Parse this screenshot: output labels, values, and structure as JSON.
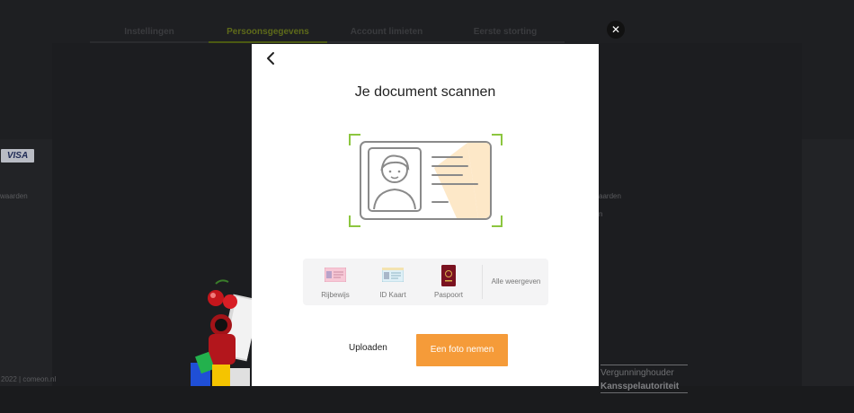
{
  "steps": [
    "Instellingen",
    "Persoonsgegevens",
    "Account limieten",
    "Eerste storting"
  ],
  "background": {
    "visa_label": "VISA",
    "left_text": "waarden",
    "right_text_1": "aarden",
    "right_text_2": "n",
    "footer_text": "2022 | comeon.nl",
    "license_line1": "Vergunninghouder",
    "license_line2": "Kansspelautoriteit"
  },
  "modal": {
    "title": "Je document scannen",
    "documents": [
      {
        "label": "Rijbewijs",
        "icon": "drivers-license-icon"
      },
      {
        "label": "ID Kaart",
        "icon": "id-card-icon"
      },
      {
        "label": "Paspoort",
        "icon": "passport-icon"
      }
    ],
    "show_all_label": "Alle weergeven",
    "upload_label": "Uploaden",
    "photo_label": "Een foto nemen"
  },
  "colors": {
    "accent": "#f59b39",
    "scan_frame": "#8cc63f",
    "active_step": "#5e6a1a"
  }
}
